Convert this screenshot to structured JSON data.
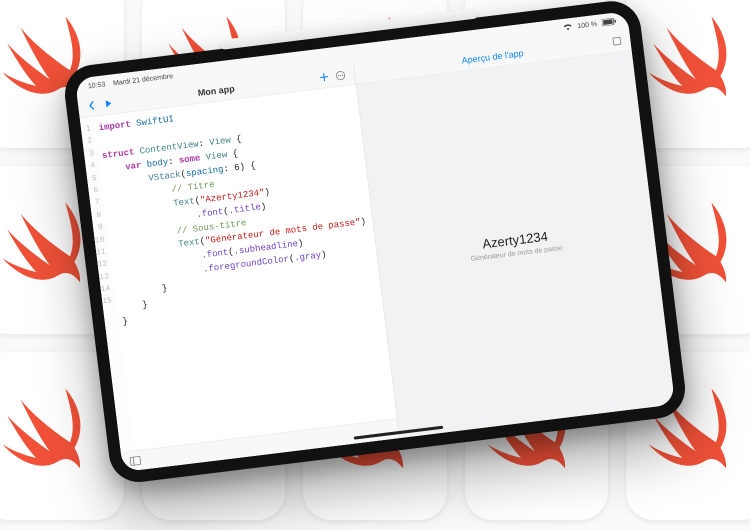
{
  "background": {
    "logo_name": "swift-logo"
  },
  "statusbar": {
    "time": "10:53",
    "date": "Mardi 21 décembre",
    "battery": "100 %"
  },
  "editor": {
    "header": {
      "back_icon": "chevron-left",
      "run_icon": "play",
      "title": "Mon app",
      "add_icon": "plus",
      "more_icon": "ellipsis-circle"
    },
    "code": {
      "line1_import": "import",
      "line1_module": "SwiftUI",
      "line3_struct": "struct",
      "line3_name": "ContentView",
      "line3_proto": "View",
      "line4_var": "var",
      "line4_body": "body",
      "line4_some": "some",
      "line4_view": "View",
      "line5_vstack": "VStack",
      "line5_spacing_label": "spacing",
      "line5_spacing_val": "6",
      "line6_comment": "// Titre",
      "line7_text": "Text",
      "line7_str": "\"Azerty1234\"",
      "line8_font": ".font",
      "line8_title": ".title",
      "line9_comment": "// Sous-titre",
      "line10_text": "Text",
      "line10_str": "\"Générateur de mots de passe\"",
      "line11_font": ".font",
      "line11_sub": ".subheadline",
      "line12_fg": ".foregroundColor",
      "line12_gray": ".gray"
    },
    "footer": {
      "panel_icon": "sidebar-left"
    }
  },
  "preview": {
    "header": {
      "title": "Aperçu de l'app",
      "expand_icon": "rectangle-expand"
    },
    "content": {
      "title": "Azerty1234",
      "subtitle": "Générateur de mots de passe"
    }
  }
}
